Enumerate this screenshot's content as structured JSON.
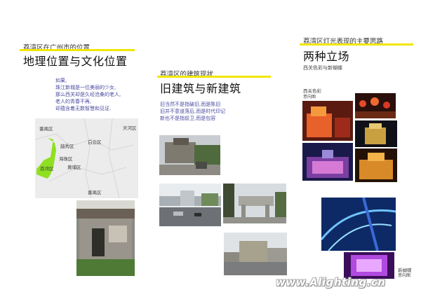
{
  "section1": {
    "subtitle": "荔湾区在广州市的位置",
    "title": "地理位置与文化位置",
    "text": [
      "如果,",
      "珠江新城是一位美丽的少女,",
      "那么西关却是久经沧桑的老人,",
      "老人的青春不再,",
      "却蕴含着无数智慧和见证."
    ],
    "map_labels": [
      "番禺区",
      "越秀区",
      "白云区",
      "海珠区",
      "荔湾区",
      "黄埔区",
      "天河区",
      "番禺区"
    ]
  },
  "section2": {
    "subtitle": "荔湾区的建筑现状",
    "title": "旧建筑与新建筑",
    "text": [
      "旧当然不是指破旧,而是陈旧",
      "旧并不意道落后,而是时代印记",
      "新也不是指前卫,而是包容"
    ]
  },
  "section3": {
    "subtitle": "荔湾区灯光表现的主要思路",
    "title": "两种立场",
    "tagline": "西关色彩与新蝴蝶",
    "label1": "西关色彩",
    "label1_sub": "意向图",
    "label2": "新蝴蝶",
    "label2_sub": "意向图"
  },
  "watermark": "www.Alighting.cn",
  "colors": {
    "accent_yellow": "#f2e600",
    "map_green": "#8fe020",
    "text_blue": "#4a4aa0"
  }
}
